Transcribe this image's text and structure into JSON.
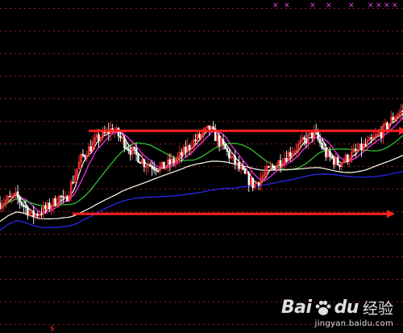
{
  "chart_data": {
    "type": "candlestick",
    "title": "",
    "xlabel": "",
    "ylabel": "",
    "grid": "horizontal dotted",
    "colors": {
      "background": "#000000",
      "grid": "#8a2020",
      "candle_up": "#ff3232",
      "candle_down": "#ffffff",
      "ma_short": "#ffffff",
      "ma_mid": "#ff33ff",
      "ma_long1": "#33cc33",
      "ma_long2": "#ffffee",
      "ma_longest": "#2a2aff",
      "channel_lines": "#ff2020",
      "markers": "#ff44ff"
    },
    "trendlines": [
      {
        "name": "resistance",
        "from": [
          0.22,
          0.63
        ],
        "to": [
          0.99,
          0.63
        ],
        "style": "arrow"
      },
      {
        "name": "support",
        "from": [
          0.18,
          0.25
        ],
        "to": [
          0.96,
          0.25
        ],
        "style": "arrow"
      }
    ]
  },
  "watermark": {
    "bai": "Bai",
    "du": "du",
    "cn": "经验",
    "url": "jingyan.baidu.com"
  }
}
